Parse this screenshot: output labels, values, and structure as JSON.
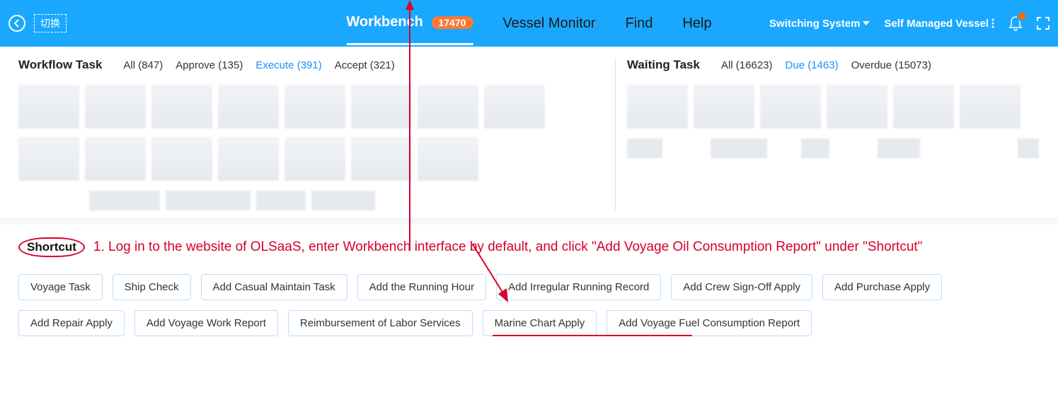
{
  "topbar": {
    "switch_label": "切换",
    "nav": {
      "workbench": "Workbench",
      "workbench_badge": "17470",
      "vessel_monitor": "Vessel Monitor",
      "find": "Find",
      "help": "Help"
    },
    "right": {
      "switching_system": "Switching System",
      "self_managed": "Self Managed Vessel"
    }
  },
  "workflow": {
    "title": "Workflow Task",
    "filters": {
      "all": "All (847)",
      "approve": "Approve (135)",
      "execute": "Execute (391)",
      "accept": "Accept (321)"
    }
  },
  "waiting": {
    "title": "Waiting Task",
    "filters": {
      "all": "All (16623)",
      "due": "Due (1463)",
      "overdue": "Overdue (15073)"
    }
  },
  "shortcut": {
    "label": "Shortcut",
    "instruction": "1. Log in to the website of OLSaaS, enter Workbench interface by default, and click \"Add Voyage Oil Consumption Report\" under \"Shortcut\"",
    "buttons": {
      "voyage_task": "Voyage Task",
      "ship_check": "Ship Check",
      "add_casual_maintain": "Add Casual Maintain Task",
      "add_running_hour": "Add the Running Hour",
      "add_irregular_running": "Add Irregular Running Record",
      "add_crew_signoff": "Add Crew Sign-Off Apply",
      "add_purchase": "Add Purchase Apply",
      "add_repair": "Add Repair Apply",
      "add_voyage_work": "Add Voyage Work Report",
      "reimbursement_labor": "Reimbursement of Labor Services",
      "marine_chart": "Marine Chart Apply",
      "add_voyage_fuel": "Add Voyage Fuel Consumption Report"
    }
  }
}
